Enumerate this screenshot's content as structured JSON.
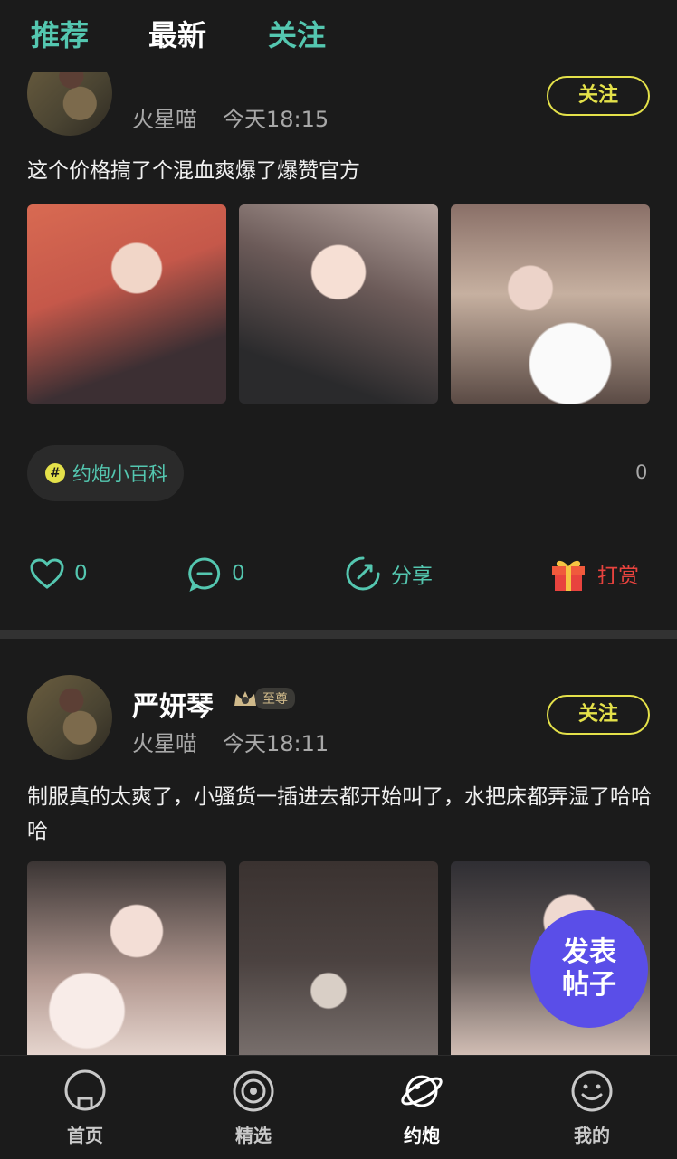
{
  "top_tabs": {
    "recommended": "推荐",
    "latest": "最新",
    "following": "关注"
  },
  "post1": {
    "name_partial": "",
    "meta_source": "火星喵",
    "meta_time": "今天18:15",
    "follow_label": "关注",
    "content": "这个价格搞了个混血爽爆了爆赞官方",
    "topic_label": "约炮小百科",
    "topic_count": "0",
    "like_count": "0",
    "comment_count": "0",
    "share_label": "分享",
    "reward_label": "打赏"
  },
  "post2": {
    "name": "严妍琴",
    "badge": "至尊",
    "meta_source": "火星喵",
    "meta_time": "今天18:11",
    "follow_label": "关注",
    "content": "制服真的太爽了，小骚货一插进去都开始叫了，水把床都弄湿了哈哈哈"
  },
  "fab": {
    "label": "发表帖子"
  },
  "bottom_nav": [
    {
      "label": "首页",
      "icon": "home-icon"
    },
    {
      "label": "精选",
      "icon": "target-icon"
    },
    {
      "label": "约炮",
      "icon": "planet-icon"
    },
    {
      "label": "我的",
      "icon": "smile-icon"
    }
  ],
  "colors": {
    "accent": "#54c7b0",
    "follow": "#e4e14a",
    "reward": "#e8433e",
    "fab": "#5a4ee8",
    "background": "#1b1b1b"
  }
}
